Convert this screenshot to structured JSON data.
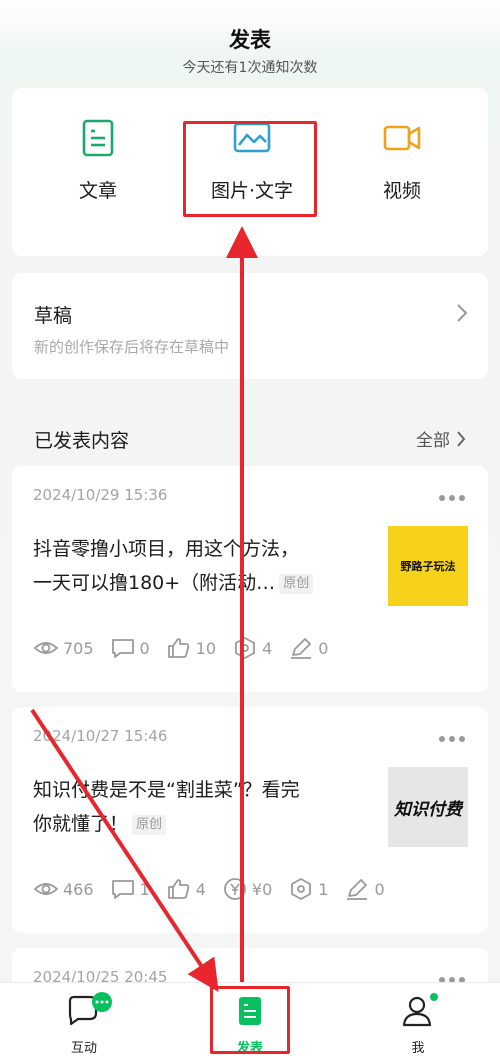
{
  "header": {
    "title": "发表",
    "subtitle": "今天还有1次通知次数"
  },
  "publish_options": [
    {
      "label": "文章",
      "icon": "article-icon",
      "color": "#1aa86b"
    },
    {
      "label": "图片·文字",
      "icon": "image-text-icon",
      "color": "#2e9ed6"
    },
    {
      "label": "视频",
      "icon": "video-icon",
      "color": "#f0a21a"
    }
  ],
  "drafts": {
    "title": "草稿",
    "description": "新的创作保存后将存在草稿中"
  },
  "published": {
    "title": "已发表内容",
    "all_label": "全部"
  },
  "posts": [
    {
      "date": "2024/10/29 15:36",
      "title_line1": "抖音零撸小项目，用这个方法，",
      "title_line2": "一天可以撸180+（附活动…",
      "badge": "原创",
      "thumb_text": "野路子玩法",
      "thumb_bg": "#f7d21c",
      "views": "705",
      "comments": "0",
      "likes": "10",
      "shares": "4",
      "edits": "0"
    },
    {
      "date": "2024/10/27 15:46",
      "title_line1": "知识付费是不是“割韭菜”？看完",
      "title_line2": "你就懂了！",
      "badge": "原创",
      "thumb_text": "知识付费",
      "thumb_bg": "#e6e6e6",
      "views": "466",
      "comments": "1",
      "likes": "4",
      "income": "¥0",
      "shares": "1",
      "edits": "0"
    },
    {
      "date": "2024/10/25 20:45"
    }
  ],
  "nav": [
    {
      "label": "互动",
      "icon": "chat-icon"
    },
    {
      "label": "发表",
      "icon": "publish-icon"
    },
    {
      "label": "我",
      "icon": "user-icon"
    }
  ],
  "colors": {
    "accent": "#07c160",
    "annotation_red": "#e8262e"
  }
}
